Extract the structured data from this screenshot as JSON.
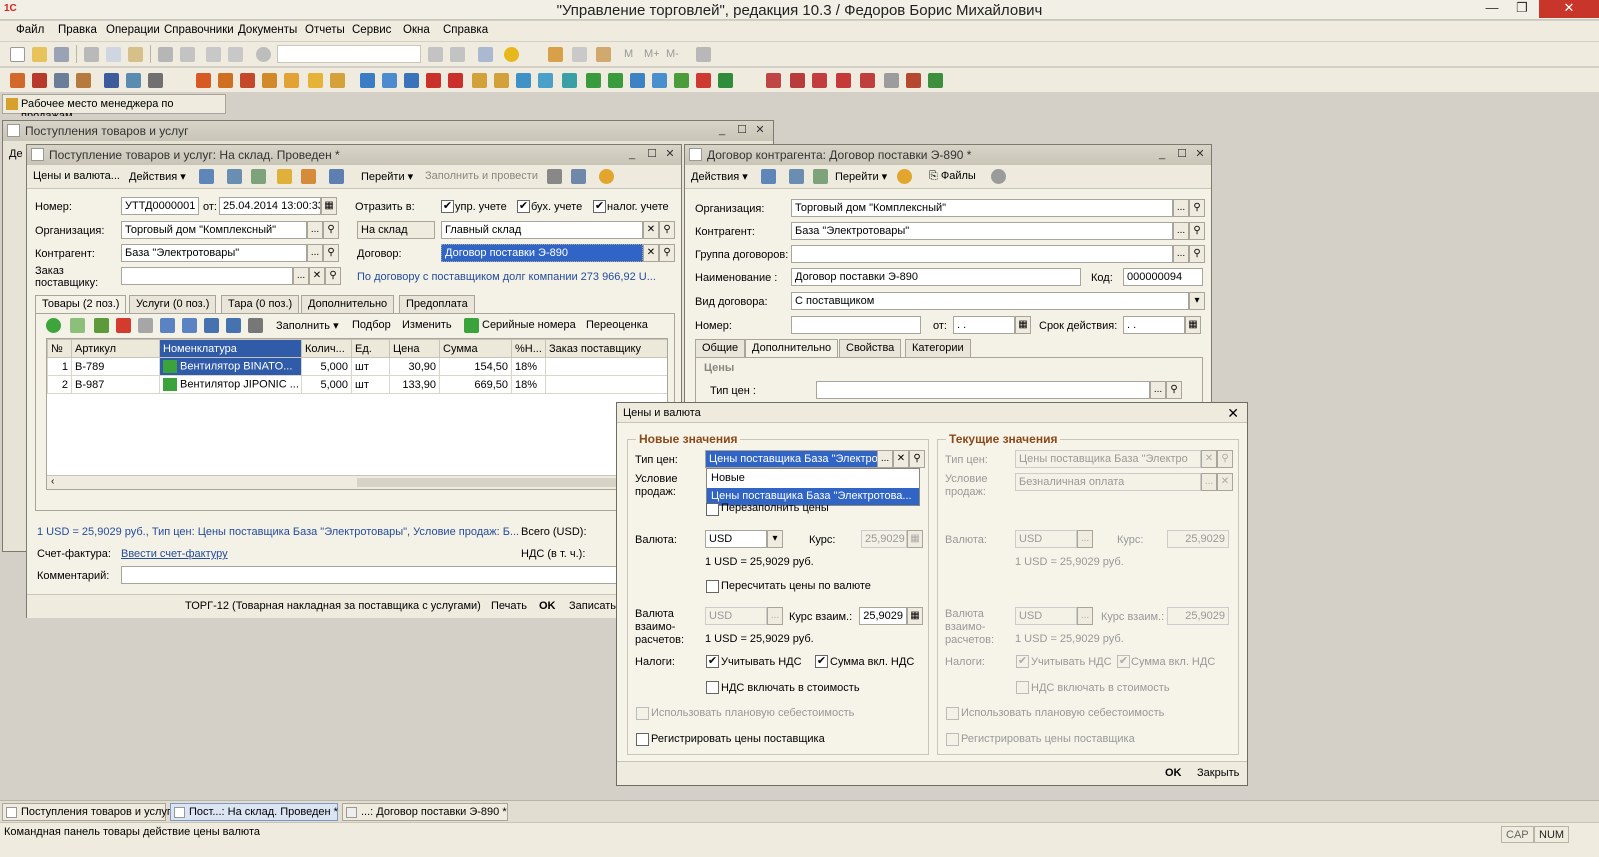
{
  "app": {
    "title": "\"Управление торговлей\", редакция 10.3 / Федоров Борис Михайлович",
    "logo_text": "1С"
  },
  "menu": [
    "Файл",
    "Правка",
    "Операции",
    "Справочники",
    "Документы",
    "Отчеты",
    "Сервис",
    "Окна",
    "Справка"
  ],
  "workplace_button": "Рабочее место менеджера по продажам",
  "bg_window": {
    "title": "Поступления товаров и услуг",
    "tab_fragment": "Де"
  },
  "doc": {
    "title": "Поступление товаров и услуг: На склад. Проведен *",
    "cmd": {
      "prices": "Цены и валюта...",
      "actions": "Действия",
      "goto": "Перейти",
      "fill_post": "Заполнить и провести"
    },
    "number_label": "Номер:",
    "number": "УТТД0000001",
    "from_label": "от:",
    "date": "25.04.2014 13:00:33",
    "reflect_label": "Отразить в:",
    "reflect": [
      "упр. учете",
      "бух. учете",
      "налог. учете"
    ],
    "org_label": "Организация:",
    "org": "Торговый дом \"Комплексный\"",
    "warehouse_kind": "На склад",
    "warehouse": "Главный склад",
    "contractor_label": "Контрагент:",
    "contractor": "База \"Электротовары\"",
    "contract_label": "Договор:",
    "contract": "Договор поставки Э-890",
    "order_label": "Заказ поставщику:",
    "debt": "По договору с поставщиком долг компании 273 966,92 U...",
    "tabs": [
      "Товары (2 поз.)",
      "Услуги (0 поз.)",
      "Тара (0 поз.)",
      "Дополнительно",
      "Предоплата"
    ],
    "grid_cmds": {
      "fill": "Заполнить",
      "pick": "Подбор",
      "change": "Изменить",
      "serial": "Серийные номера",
      "reprice": "Переоценка"
    },
    "columns": [
      "№",
      "Артикул",
      "Номенклатура",
      "Колич...",
      "Ед.",
      "Цена",
      "Сумма",
      "%Н...",
      "Заказ поставщику"
    ],
    "rows": [
      {
        "n": "1",
        "art": "В-789",
        "name": "Вентилятор BINATO...",
        "qty": "5,000",
        "unit": "шт",
        "price": "30,90",
        "sum": "154,50",
        "vat": "18%",
        "order": ""
      },
      {
        "n": "2",
        "art": "В-987",
        "name": "Вентилятор JIPONIC ...",
        "qty": "5,000",
        "unit": "шт",
        "price": "133,90",
        "sum": "669,50",
        "vat": "18%",
        "order": ""
      }
    ],
    "info": "1 USD = 25,9029 руб., Тип цен: Цены поставщика База  \"Электротовары\", Условие продаж: Б...",
    "total_label": "Всего (USD):",
    "invoice_label": "Счет-фактура:",
    "invoice_link": "Ввести счет-фактуру",
    "vat_label": "НДС (в т. ч.):",
    "comment_label": "Комментарий:",
    "bottom": {
      "torg": "ТОРГ-12 (Товарная накладная за поставщика с услугами)",
      "print": "Печать",
      "ok": "OK",
      "save": "Записать"
    }
  },
  "contract": {
    "title": "Договор контрагента: Договор поставки Э-890 *",
    "cmd": {
      "actions": "Действия",
      "goto": "Перейти",
      "files": "Файлы"
    },
    "org_label": "Организация:",
    "org": "Торговый дом \"Комплексный\"",
    "contractor_label": "Контрагент:",
    "contractor": "База \"Электротовары\"",
    "group_label": "Группа договоров:",
    "name_label": "Наименование :",
    "name": "Договор поставки Э-890",
    "code_label": "Код:",
    "code": "000000094",
    "kind_label": "Вид договора:",
    "kind": "С поставщиком",
    "num_label": "Номер:",
    "from_label": "от:",
    "date_placeholder": " .  .",
    "term_label": "Срок действия:",
    "tabs": [
      "Общие",
      "Дополнительно",
      "Свойства",
      "Категории"
    ],
    "prices_group": "Цены",
    "price_type_label": "Тип цен :"
  },
  "dialog": {
    "title": "Цены и валюта",
    "new_group": "Новые значения",
    "cur_group": "Текущие значения",
    "price_type_label": "Тип цен:",
    "price_type": "Цены поставщика База  \"Электротс",
    "cur_price_type": "Цены поставщика База  \"Электро",
    "cond_label": "Условие продаж:",
    "cur_cond": "Безналичная оплата",
    "dropdown": [
      "Новые",
      "Цены поставщика База  \"Электротова..."
    ],
    "refill": "Перезаполнить цены",
    "currency_label": "Валюта:",
    "currency": "USD",
    "rate_label": "Курс:",
    "rate": "25,9029",
    "rate_text": "1 USD = 25,9029 руб.",
    "recalc": "Пересчитать цены по валюте",
    "settle_label": "Валюта взаимо-расчетов:",
    "settle": "USD",
    "settle_rate_label": "Курс взаим.:",
    "settle_rate": "25,9029",
    "taxes_label": "Налоги:",
    "vat": "Учитывать НДС",
    "vat_incl": "Сумма вкл. НДС",
    "vat_cost": "НДС включать в стоимость",
    "plan_cost": "Использовать плановую себестоимость",
    "register": "Регистрировать цены поставщика",
    "ok": "OK",
    "close": "Закрыть"
  },
  "taskbar": [
    "Поступления товаров и услуг",
    "Пост...: На склад. Проведен *",
    "...: Договор поставки Э-890 *"
  ],
  "status": {
    "text": "Командная панель товары действие цены валюта",
    "cap": "CAP",
    "num": "NUM"
  }
}
